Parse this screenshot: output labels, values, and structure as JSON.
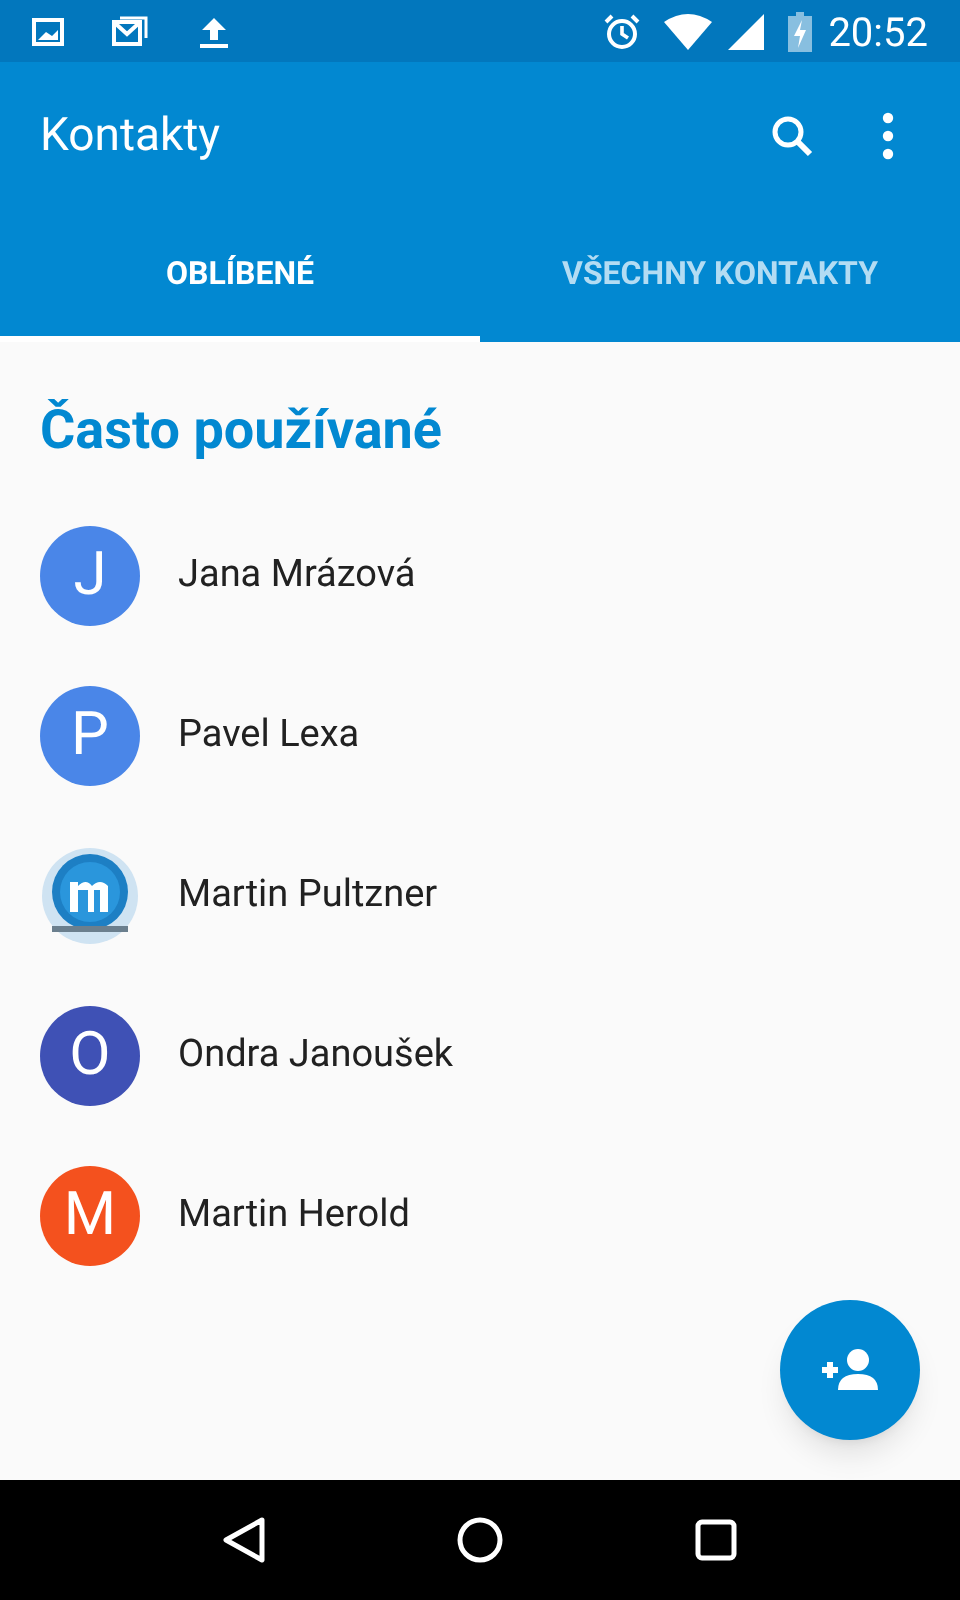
{
  "status_bar": {
    "time": "20:52"
  },
  "app_bar": {
    "title": "Kontakty"
  },
  "tabs": [
    {
      "label": "OBLÍBENÉ",
      "selected": true
    },
    {
      "label": "VŠECHNY KONTAKTY",
      "selected": false
    }
  ],
  "section": {
    "title": "Často používané"
  },
  "contacts": [
    {
      "name": "Jana Mrázová",
      "kind": "letter",
      "initial": "J",
      "color": "#4a86e8"
    },
    {
      "name": "Pavel Lexa",
      "kind": "letter",
      "initial": "P",
      "color": "#4a86e8"
    },
    {
      "name": "Martin Pultzner",
      "kind": "picture"
    },
    {
      "name": "Ondra Janoušek",
      "kind": "letter",
      "initial": "O",
      "color": "#3f51b5"
    },
    {
      "name": "Martin Herold",
      "kind": "letter",
      "initial": "M",
      "color": "#f4511e"
    }
  ]
}
